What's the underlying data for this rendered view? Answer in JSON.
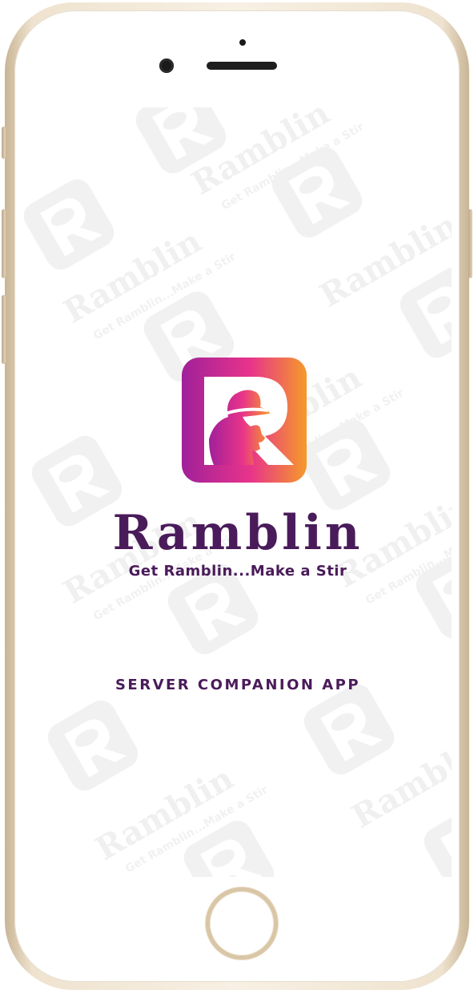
{
  "splash": {
    "app_name": "Ramblin",
    "tagline": "Get Ramblin...Make a Stir",
    "subtitle": "SERVER COMPANION APP",
    "watermark_text": "Ramblin",
    "watermark_tagline": "Get Ramblin...Make a Stir"
  },
  "colors": {
    "brand_purple": "#4a1b5a",
    "logo_gradient_start": "#a0209a",
    "logo_gradient_mid": "#e8348a",
    "logo_gradient_end": "#f59a2a"
  },
  "icons": {
    "logo": "ramblin-logo-icon",
    "watermark": "ramblin-watermark-icon"
  }
}
